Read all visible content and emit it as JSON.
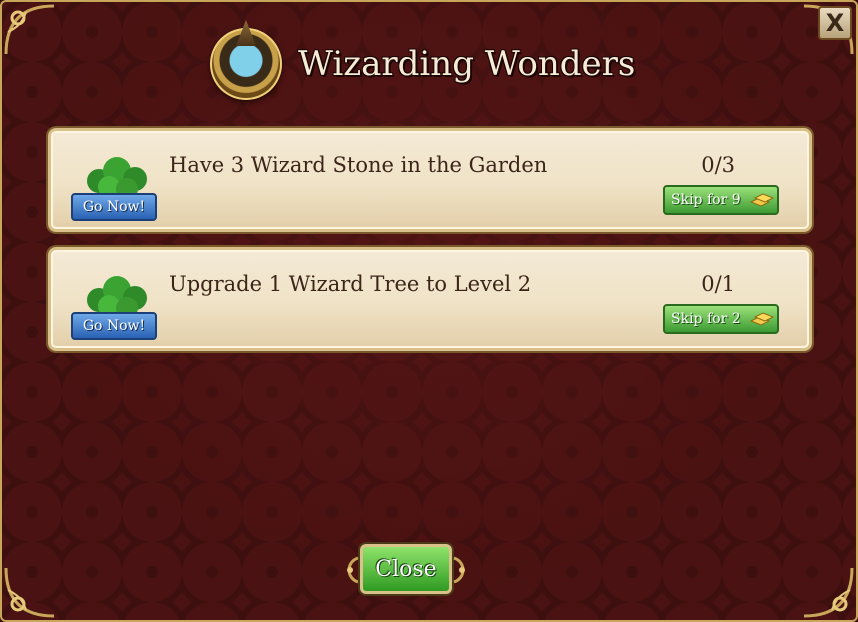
{
  "dialog": {
    "title": "Wizarding Wonders",
    "close_x_label": "X",
    "close_button_label": "Close"
  },
  "tasks": [
    {
      "description": "Have 3 Wizard Stone in the Garden",
      "progress": "0/3",
      "go_label": "Go Now!",
      "skip_label": "Skip for 9"
    },
    {
      "description": "Upgrade 1 Wizard Tree to Level 2",
      "progress": "0/1",
      "go_label": "Go Now!",
      "skip_label": "Skip for 2"
    }
  ],
  "icons": {
    "title": "wizard-medallion-icon",
    "task": "wizard-tree-icon",
    "currency": "gold-bars-icon"
  },
  "colors": {
    "background": "#4a1212",
    "go_button": "#2a62b4",
    "skip_button": "#3d9a32",
    "close_button": "#2f9a22",
    "panel": "#efe2c6",
    "frame_gold": "#c9a75a"
  }
}
